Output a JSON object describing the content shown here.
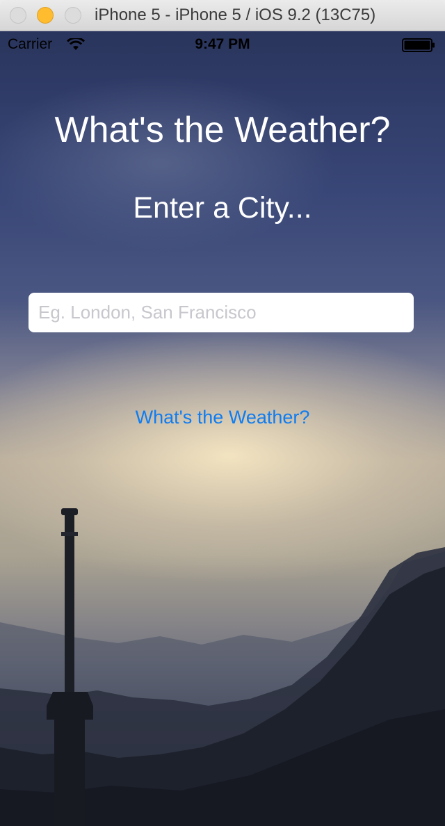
{
  "window": {
    "title": "iPhone 5 - iPhone 5 / iOS 9.2 (13C75)"
  },
  "status_bar": {
    "carrier": "Carrier",
    "time": "9:47 PM",
    "icons": [
      "wifi-icon",
      "battery-icon"
    ]
  },
  "main": {
    "title": "What's the Weather?",
    "subtitle": "Enter a City...",
    "city_input": {
      "value": "",
      "placeholder": "Eg. London, San Francisco"
    },
    "submit_label": "What's the Weather?"
  },
  "colors": {
    "accent": "#0f7cf0",
    "text_on_background": "#ffffff",
    "minimize_light": "#febc2e"
  }
}
